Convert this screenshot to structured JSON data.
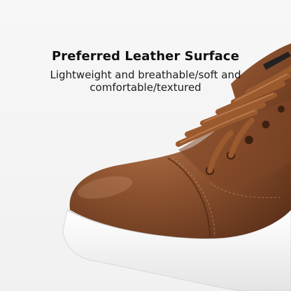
{
  "headline": "Preferred Leather Surface",
  "subline": "Lightweight and breathable/soft and comfortable/textured",
  "colors": {
    "leather": "#8a4e2c",
    "leather_dark": "#5e321b",
    "leather_light": "#b0714a",
    "lace": "#9a5a2e",
    "sole": "#ffffff",
    "background": "#f4f4f4"
  }
}
